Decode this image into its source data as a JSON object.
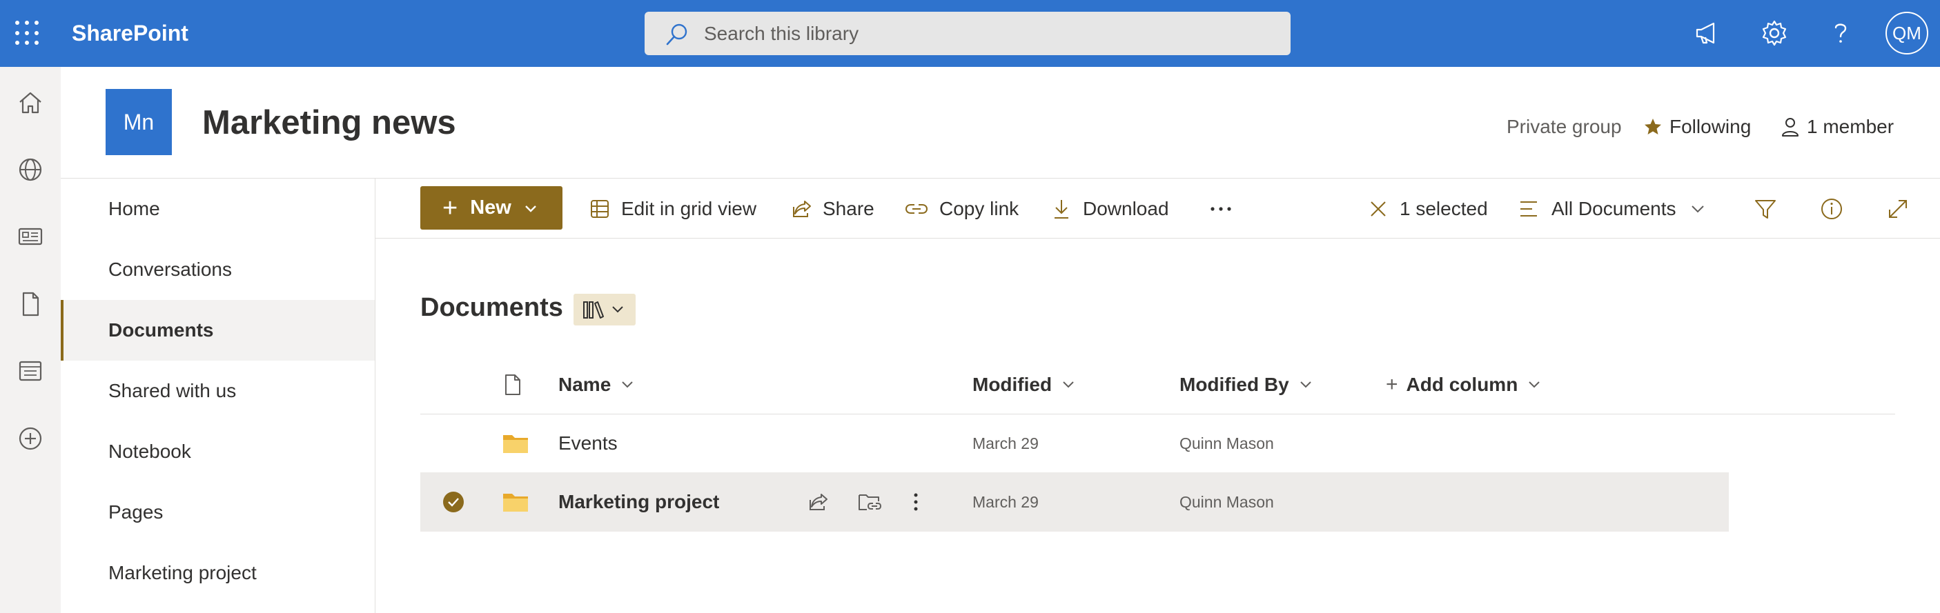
{
  "header": {
    "app_name": "SharePoint",
    "search_placeholder": "Search this library",
    "user_initials": "QM"
  },
  "site": {
    "logo_text": "Mn",
    "title": "Marketing news",
    "privacy": "Private group",
    "follow_label": "Following",
    "members_label": "1 member"
  },
  "nav": {
    "items": [
      {
        "label": "Home"
      },
      {
        "label": "Conversations"
      },
      {
        "label": "Documents",
        "active": true
      },
      {
        "label": "Shared with us"
      },
      {
        "label": "Notebook"
      },
      {
        "label": "Pages"
      },
      {
        "label": "Marketing project"
      }
    ]
  },
  "commandbar": {
    "new_label": "New",
    "edit_grid_label": "Edit in grid view",
    "share_label": "Share",
    "copy_link_label": "Copy link",
    "download_label": "Download",
    "selected_label": "1 selected",
    "view_label": "All Documents"
  },
  "library": {
    "title": "Documents",
    "columns": {
      "name": "Name",
      "modified": "Modified",
      "modified_by": "Modified By",
      "add_column": "Add column"
    },
    "rows": [
      {
        "name": "Events",
        "modified": "March 29",
        "modified_by": "Quinn Mason",
        "selected": false
      },
      {
        "name": "Marketing project",
        "modified": "March 29",
        "modified_by": "Quinn Mason",
        "selected": true
      }
    ]
  },
  "colors": {
    "suite_bar": "#2f73cd",
    "accent": "#8b6a1d",
    "folder": "#f7c948",
    "selected_row": "#edebe9"
  }
}
